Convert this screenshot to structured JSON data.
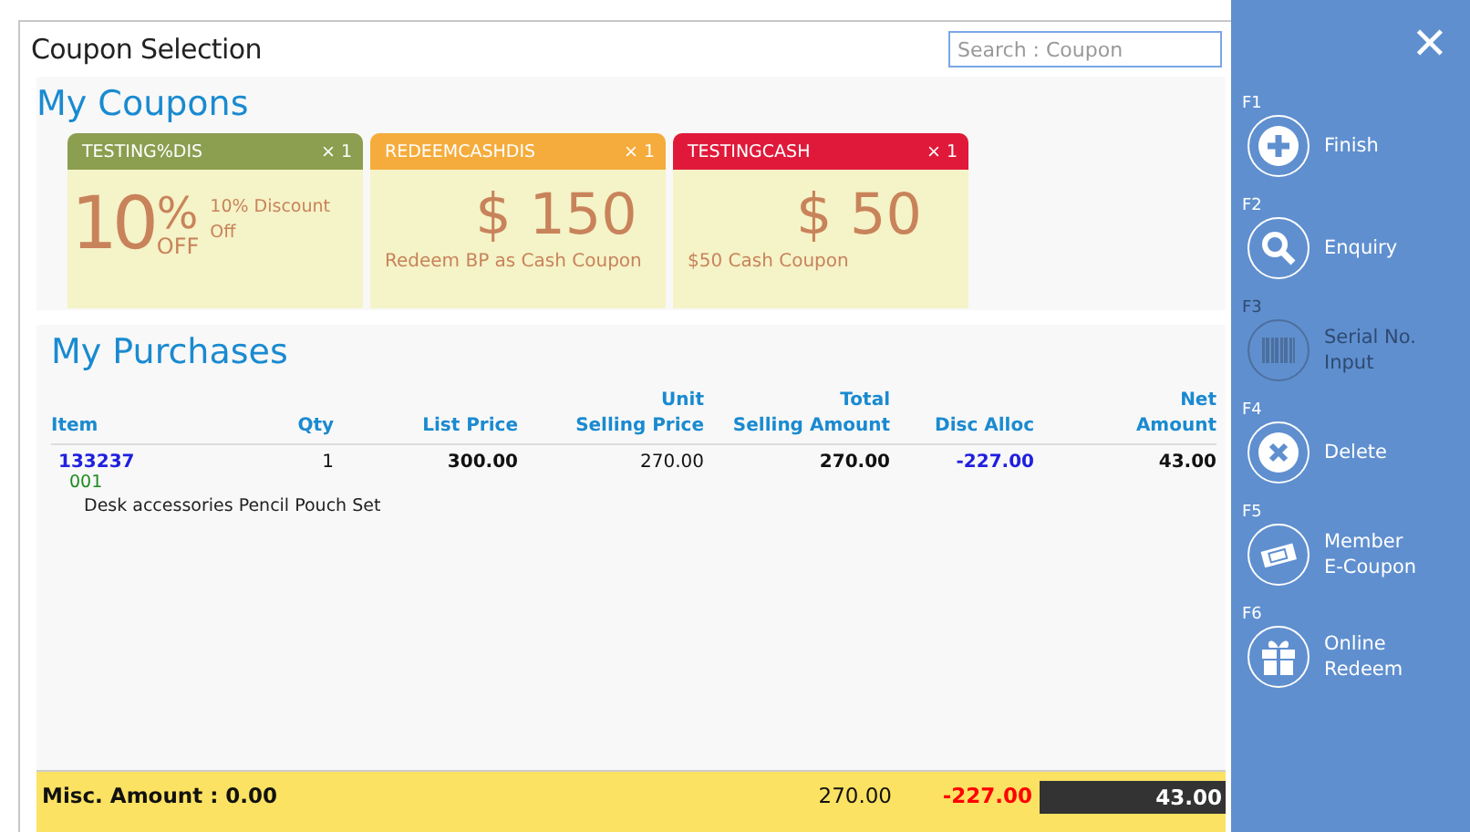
{
  "window": {
    "title": "Coupon Selection"
  },
  "search": {
    "placeholder": "Search : Coupon"
  },
  "coupons_section": {
    "title": "My Coupons"
  },
  "coupons": [
    {
      "kind": "percent",
      "name": "TESTING%DIS",
      "count": "× 1",
      "color": "#8c9e50",
      "value": "10",
      "unit": "%",
      "unit_sub": "OFF",
      "description": "10% Discount Off"
    },
    {
      "kind": "cash",
      "name": "REDEEMCASHDIS",
      "count": "× 1",
      "color": "#f5ac3c",
      "value": "$ 150",
      "description": "Redeem BP as Cash Coupon"
    },
    {
      "kind": "cash",
      "name": "TESTINGCASH",
      "count": "× 1",
      "color": "#e0193a",
      "value": "$ 50",
      "description": "$50 Cash Coupon"
    }
  ],
  "purchases_section": {
    "title": "My Purchases"
  },
  "table": {
    "columns": [
      [
        "Item"
      ],
      [
        "Qty"
      ],
      [
        "List Price"
      ],
      [
        "Unit",
        "Selling Price"
      ],
      [
        "Total",
        "Selling Amount"
      ],
      [
        "Disc Alloc"
      ],
      [
        "Net",
        "Amount"
      ]
    ],
    "rows": [
      {
        "item": "133237",
        "variant": "001",
        "description": "Desk accessories Pencil Pouch Set",
        "qty": "1",
        "list_price": "300.00",
        "unit_price": "270.00",
        "total": "270.00",
        "disc": "-227.00",
        "net": "43.00"
      }
    ]
  },
  "footer": {
    "misc": "Misc. Amount : 0.00",
    "total": "270.00",
    "disc": "-227.00",
    "net": "43.00"
  },
  "sidebar": {
    "close": "✕",
    "actions": [
      {
        "key": "F1",
        "label": [
          "Finish"
        ],
        "disabled": false
      },
      {
        "key": "F2",
        "label": [
          "Enquiry"
        ],
        "disabled": false
      },
      {
        "key": "F3",
        "label": [
          "Serial No.",
          "Input"
        ],
        "disabled": true
      },
      {
        "key": "F4",
        "label": [
          "Delete"
        ],
        "disabled": false
      },
      {
        "key": "F5",
        "label": [
          "Member",
          "E-Coupon"
        ],
        "disabled": false
      },
      {
        "key": "F6",
        "label": [
          "Online",
          "Redeem"
        ],
        "disabled": false
      }
    ]
  }
}
